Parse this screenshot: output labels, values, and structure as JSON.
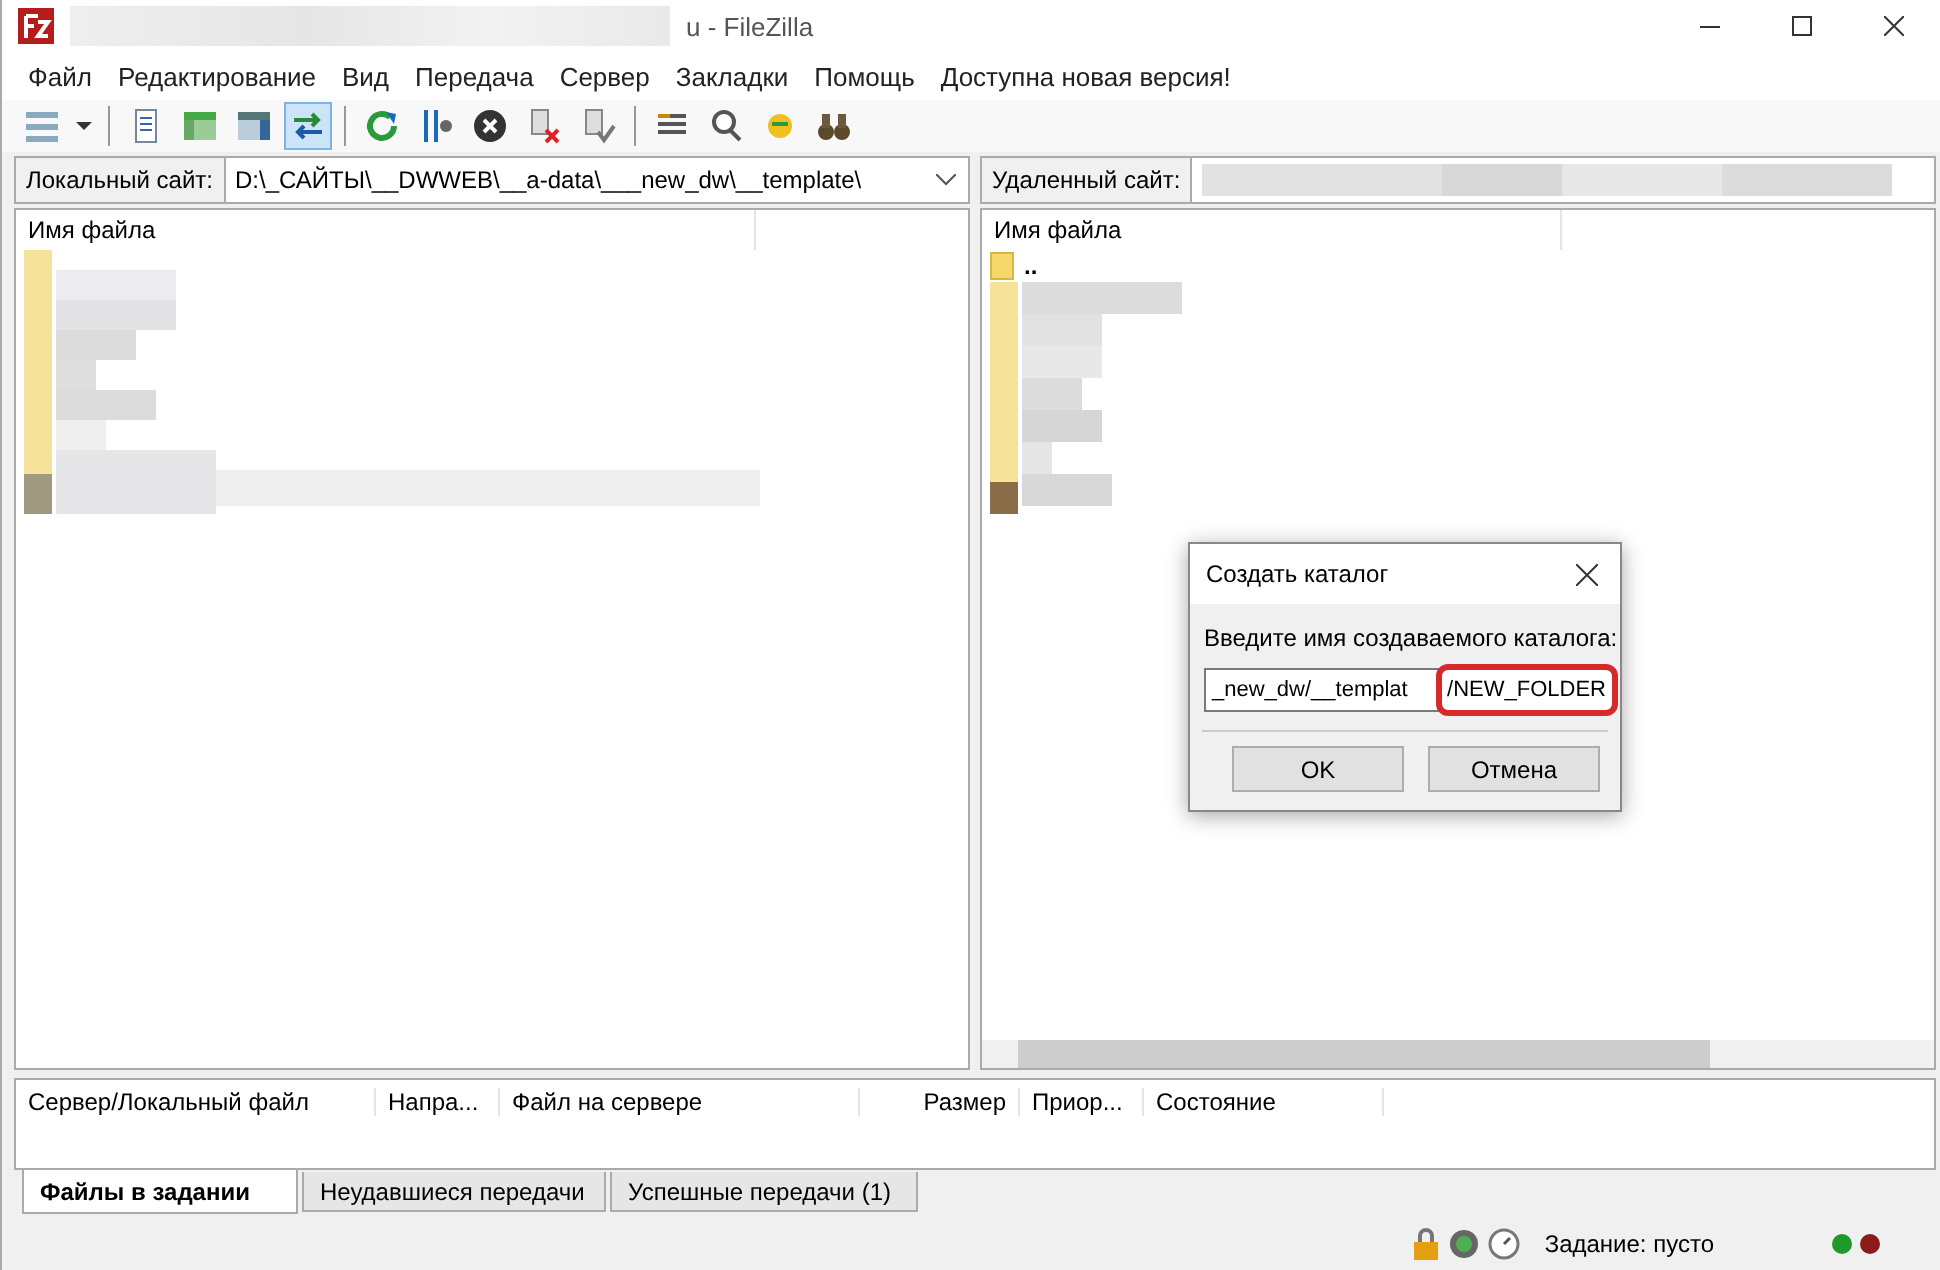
{
  "window": {
    "title": "u - FileZilla"
  },
  "menu": [
    "Файл",
    "Редактирование",
    "Вид",
    "Передача",
    "Сервер",
    "Закладки",
    "Помощь",
    "Доступна новая версия!"
  ],
  "toolbar": [
    {
      "kind": "sitemanager",
      "selected": false
    },
    {
      "kind": "dropdown",
      "selected": false
    },
    {
      "kind": "separator"
    },
    {
      "kind": "log",
      "selected": false
    },
    {
      "kind": "localtree",
      "selected": false
    },
    {
      "kind": "remotetree",
      "selected": false
    },
    {
      "kind": "sync",
      "selected": true
    },
    {
      "kind": "separator"
    },
    {
      "kind": "refresh",
      "selected": false
    },
    {
      "kind": "filters",
      "selected": false
    },
    {
      "kind": "cancel",
      "selected": false
    },
    {
      "kind": "disconnect",
      "selected": false
    },
    {
      "kind": "reconnect",
      "selected": false
    },
    {
      "kind": "separator"
    },
    {
      "kind": "queue",
      "selected": false
    },
    {
      "kind": "search",
      "selected": false
    },
    {
      "kind": "compare",
      "selected": false
    },
    {
      "kind": "find",
      "selected": false
    }
  ],
  "local": {
    "label": "Локальный сайт:",
    "path": "D:\\_САЙТЫ\\__DWWEB\\__a-data\\___new_dw\\__template\\",
    "column": "Имя файла"
  },
  "remote": {
    "label": "Удаленный сайт:",
    "column": "Имя файла",
    "parent_entry": ".."
  },
  "dialog": {
    "title": "Создать каталог",
    "prompt": "Введите имя создаваемого каталога:",
    "value": "_new_dw/__templat",
    "highlighted_value": "/NEW_FOLDER",
    "buttons": [
      "OK",
      "Отмена"
    ]
  },
  "queue": {
    "columns": [
      "Сервер/Локальный файл",
      "Напра...",
      "Файл на сервере",
      "Размер",
      "Приор...",
      "Состояние"
    ]
  },
  "tabs": [
    {
      "label": "Файлы в задании",
      "selected": true
    },
    {
      "label": "Неудавшиеся передачи",
      "selected": false
    },
    {
      "label": "Успешные передачи (1)",
      "selected": false
    }
  ],
  "status": {
    "text": "Задание: пусто",
    "lights": [
      {
        "color": "#1f9a2a"
      },
      {
        "color": "#8a1c1c"
      }
    ]
  }
}
